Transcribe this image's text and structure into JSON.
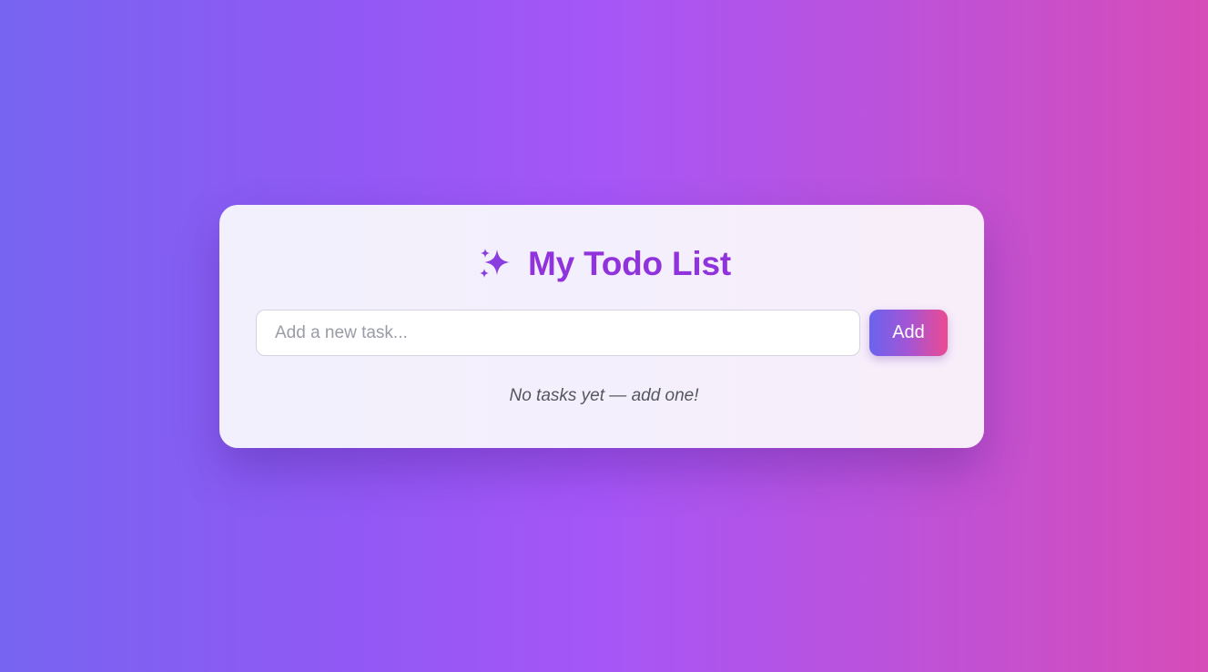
{
  "app": {
    "title": "My Todo List",
    "title_icon": "sparkles-icon"
  },
  "input": {
    "placeholder": "Add a new task...",
    "value": ""
  },
  "add_button": {
    "label": "Add"
  },
  "empty_state": {
    "message": "No tasks yet — add one!"
  },
  "colors": {
    "title": "#9133dd",
    "icon": "#8a3ee0",
    "button_gradient_start": "#6a63ee",
    "button_gradient_end": "#ec4a92",
    "background_start": "#7764f1",
    "background_end": "#d64cb8"
  }
}
